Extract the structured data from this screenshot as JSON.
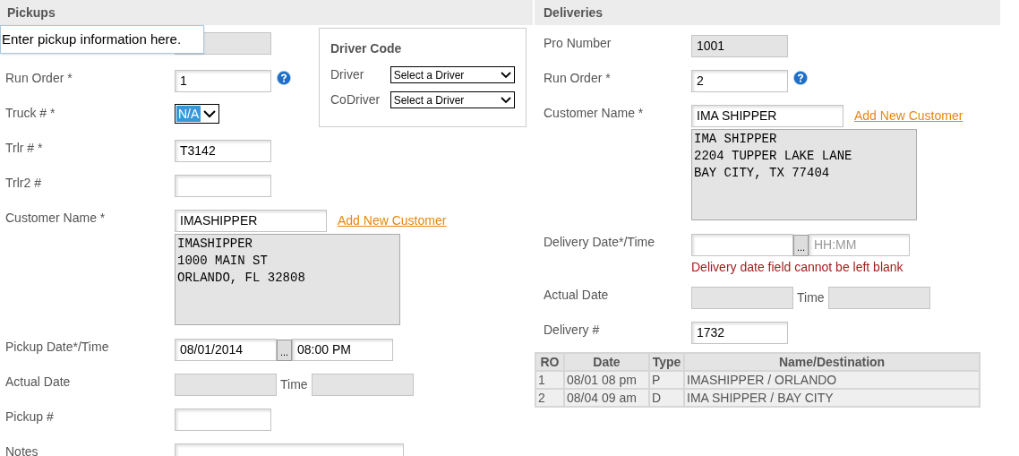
{
  "pickups": {
    "title": "Pickups",
    "tooltip": "Enter pickup information here.",
    "fields": [
      {
        "kind": "text",
        "label": "Run Order *",
        "value": "1",
        "help": true
      },
      {
        "kind": "select",
        "label": "Truck # *",
        "value": "N/A"
      },
      {
        "kind": "text",
        "label": "Trlr # *",
        "value": "T3142",
        "help": false
      },
      {
        "kind": "text",
        "label": "Trlr2 #",
        "help": false
      },
      {
        "kind": "customer",
        "label": "Customer Name *",
        "value": "IMASHIPPER",
        "link": "Add New Customer",
        "address": [
          "IMASHIPPER",
          "1000 MAIN ST",
          "ORLANDO, FL 32808"
        ]
      },
      {
        "kind": "datetime",
        "label": "Pickup Date*/Time",
        "date": "08/01/2014",
        "button": "...",
        "time": "08:00 PM"
      },
      {
        "kind": "actual",
        "label": "Actual Date",
        "time_label": "Time"
      },
      {
        "kind": "text",
        "label": "Pickup #",
        "help": false
      },
      {
        "kind": "notes",
        "label": "Notes"
      }
    ]
  },
  "driver_code": {
    "title": "Driver Code",
    "rows": [
      {
        "label": "Driver",
        "value": "Select a Driver"
      },
      {
        "label": "CoDriver",
        "value": "Select a Driver"
      }
    ]
  },
  "deliveries": {
    "title": "Deliveries",
    "fields": [
      {
        "kind": "readonly",
        "label": "Pro Number",
        "value": "1001"
      },
      {
        "kind": "text",
        "label": "Run Order *",
        "value": "2",
        "help": true
      },
      {
        "kind": "customer",
        "label": "Customer Name *",
        "value": "IMA SHIPPER",
        "link": "Add New Customer",
        "address": [
          "IMA SHIPPER",
          "2204 TUPPER LAKE LANE",
          "BAY CITY, TX 77404"
        ]
      },
      {
        "kind": "datetime",
        "label": "Delivery Date*/Time",
        "button": "...",
        "time_placeholder": "HH:MM",
        "error": "Delivery date field cannot be left blank"
      },
      {
        "kind": "actual",
        "label": "Actual Date",
        "time_label": "Time"
      },
      {
        "kind": "text",
        "label": "Delivery #",
        "value": "1732",
        "help": false
      }
    ]
  },
  "stops_table": {
    "columns": [
      "RO",
      "Date",
      "Type",
      "Name/Destination"
    ],
    "rows": [
      [
        "1",
        "08/01 08 pm",
        "P",
        "IMASHIPPER / ORLANDO"
      ],
      [
        "2",
        "08/04 09 am",
        "D",
        "IMA SHIPPER / BAY CITY"
      ]
    ]
  }
}
